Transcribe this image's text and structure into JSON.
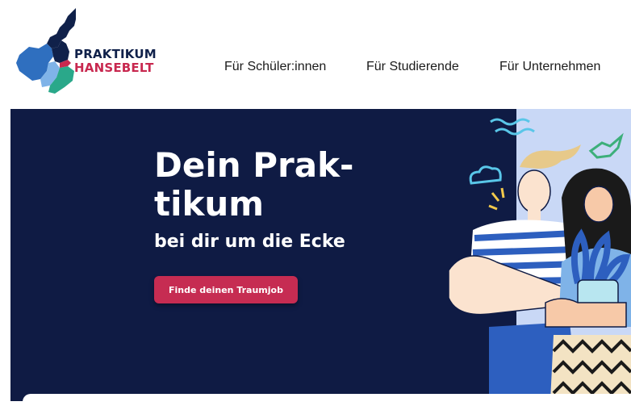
{
  "header": {
    "logo": {
      "line1": "PRAKTIKUM",
      "line2": "HANSEBELT"
    },
    "nav": [
      {
        "label": "Für Schüler:innen"
      },
      {
        "label": "Für Studierende"
      },
      {
        "label": "Für Unternehmen"
      }
    ]
  },
  "hero": {
    "title_line1": "Dein Prak-",
    "title_line2": "tikum",
    "subtitle": "bei dir um die Ecke",
    "cta_label": "Finde deinen Traumjob"
  },
  "colors": {
    "navy": "#0f1b44",
    "accent": "#c62c52",
    "light_blue": "#c9d8f6",
    "teal": "#2aa88a"
  }
}
